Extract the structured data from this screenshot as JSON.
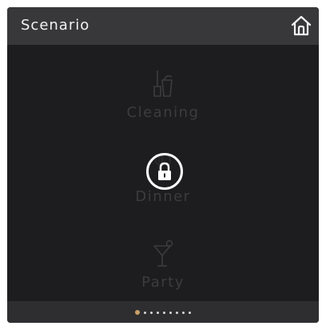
{
  "header": {
    "title": "Scenario",
    "home_icon": "home-icon"
  },
  "scenes": [
    {
      "label": "Cleaning",
      "icon": "broom-bucket-icon"
    },
    {
      "label": "Dinner",
      "icon": "cutlery-icon"
    },
    {
      "label": "Party",
      "icon": "cocktail-icon"
    }
  ],
  "lock": {
    "icon": "lock-icon",
    "state": "locked"
  },
  "pagination": {
    "total": 9,
    "active_index": 0
  },
  "colors": {
    "panel_bg": "#1d1d1f",
    "header_bg": "#38383a",
    "footer_bg": "#2e2e30",
    "dim_text": "#3c3c3e",
    "accent": "#c9a067",
    "lock_ring": "#ffffff"
  }
}
